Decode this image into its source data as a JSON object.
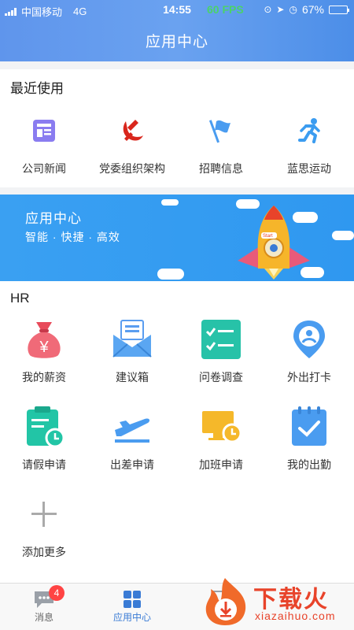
{
  "status_bar": {
    "carrier": "中国移动",
    "network": "4G",
    "time": "14:55",
    "fps": "60 FPS",
    "battery": "67%"
  },
  "header": {
    "title": "应用中心"
  },
  "recent": {
    "title": "最近使用",
    "items": [
      {
        "label": "公司新闻",
        "icon": "news-icon"
      },
      {
        "label": "党委组织架构",
        "icon": "party-emblem-icon"
      },
      {
        "label": "招聘信息",
        "icon": "flag-icon"
      },
      {
        "label": "蓝思运动",
        "icon": "runner-icon"
      }
    ]
  },
  "banner": {
    "title": "应用中心",
    "subtitle": "智能 · 快捷 · 高效",
    "rocket_text": "Start"
  },
  "hr": {
    "title": "HR",
    "items": [
      {
        "label": "我的薪资",
        "icon": "money-bag-icon"
      },
      {
        "label": "建议箱",
        "icon": "mailbox-icon"
      },
      {
        "label": "问卷调查",
        "icon": "checklist-icon"
      },
      {
        "label": "外出打卡",
        "icon": "location-pin-icon"
      },
      {
        "label": "请假申请",
        "icon": "leave-clipboard-icon"
      },
      {
        "label": "出差申请",
        "icon": "plane-icon"
      },
      {
        "label": "加班申请",
        "icon": "monitor-clock-icon"
      },
      {
        "label": "我的出勤",
        "icon": "attendance-check-icon"
      },
      {
        "label": "添加更多",
        "icon": "plus-icon"
      }
    ]
  },
  "tabbar": {
    "tabs": [
      {
        "label": "消息",
        "badge": "4",
        "icon": "chat-icon"
      },
      {
        "label": "应用中心",
        "icon": "apps-grid-icon",
        "active": true
      },
      {
        "label": "工",
        "icon": "work-icon"
      }
    ]
  },
  "watermark": {
    "name": "下载火",
    "url": "xiazaihuo.com"
  },
  "colors": {
    "primary": "#3a7bd5",
    "header": "#5f95ec",
    "banner": "#2f98f0",
    "accent_red": "#e8432a"
  }
}
